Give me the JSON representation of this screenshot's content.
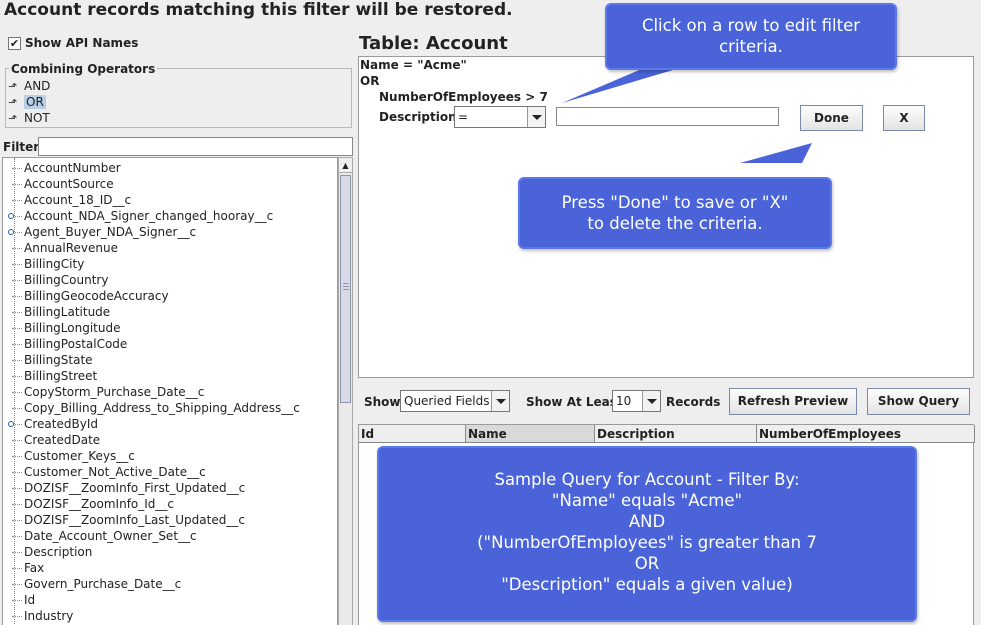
{
  "header": {
    "title": "Account records matching this filter will be restored."
  },
  "left_panel": {
    "show_api_names_label": "Show API Names",
    "show_api_names_checked": true,
    "operators_title": "Combining Operators",
    "operators": [
      "AND",
      "OR",
      "NOT"
    ],
    "selected_operator": "OR",
    "filter_label": "Filter:",
    "filter_value": "",
    "fields": [
      "AccountNumber",
      "AccountSource",
      "Account_18_ID__c",
      "Account_NDA_Signer_changed_hooray__c",
      "Agent_Buyer_NDA_Signer__c",
      "AnnualRevenue",
      "BillingCity",
      "BillingCountry",
      "BillingGeocodeAccuracy",
      "BillingLatitude",
      "BillingLongitude",
      "BillingPostalCode",
      "BillingState",
      "BillingStreet",
      "CopyStorm_Purchase_Date__c",
      "Copy_Billing_Address_to_Shipping_Address__c",
      "CreatedById",
      "CreatedDate",
      "Customer_Keys__c",
      "Customer_Not_Active_Date__c",
      "DOZISF__ZoomInfo_First_Updated__c",
      "DOZISF__ZoomInfo_Id__c",
      "DOZISF__ZoomInfo_Last_Updated__c",
      "Date_Account_Owner_Set__c",
      "Description",
      "Fax",
      "Govern_Purchase_Date__c",
      "Id",
      "Industry"
    ]
  },
  "criteria": {
    "table_title": "Table: Account",
    "line1": "Name = \"Acme\"",
    "line2": "OR",
    "line3": "NumberOfEmployees > 7",
    "edit_field_label": "Description",
    "operator_value": "=",
    "value_input": "",
    "done_label": "Done",
    "delete_label": "X"
  },
  "preview_bar": {
    "show_label": "Show:",
    "show_value": "Queried Fields",
    "at_least_label": "Show At Least",
    "at_least_value": "10",
    "records_label": "Records",
    "refresh_label": "Refresh Preview",
    "show_query_label": "Show Query"
  },
  "results_table": {
    "columns": [
      "Id",
      "Name",
      "Description",
      "NumberOfEmployees"
    ]
  },
  "callouts": {
    "row_edit": [
      "Click on a row to edit filter",
      "criteria."
    ],
    "done_hint": [
      "Press \"Done\" to save or \"X\"",
      "to delete the criteria."
    ],
    "sample_query": [
      "Sample Query for Account - Filter By:",
      "\"Name\" equals \"Acme\"",
      "AND",
      "(\"NumberOfEmployees\" is greater than 7",
      "OR",
      "\"Description\" equals a given value)"
    ]
  },
  "colors": {
    "callout_bg": "#4a63d8",
    "selection": "#b8cfe5"
  }
}
